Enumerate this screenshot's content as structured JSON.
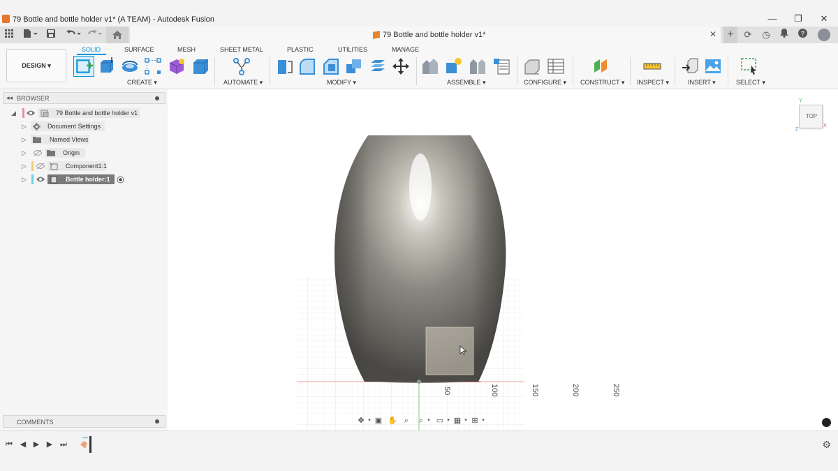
{
  "window": {
    "title": "79 Bottle and bottle holder v1* (A TEAM) - Autodesk Fusion",
    "minimize": "—",
    "maximize": "❐",
    "close": "✕"
  },
  "doc_tab": {
    "title": "79 Bottle and bottle holder v1*",
    "close": "✕"
  },
  "ribbon": {
    "workspace": "DESIGN ▾",
    "tabs": [
      "SOLID",
      "SURFACE",
      "MESH",
      "SHEET METAL",
      "PLASTIC",
      "UTILITIES",
      "MANAGE"
    ],
    "groups": [
      "CREATE ▾",
      "AUTOMATE ▾",
      "MODIFY ▾",
      "ASSEMBLE ▾",
      "CONFIGURE ▾",
      "CONSTRUCT ▾",
      "INSPECT ▾",
      "INSERT ▾",
      "SELECT ▾"
    ]
  },
  "browser": {
    "title": "BROWSER",
    "items": [
      "79 Bottle and bottle holder v1",
      "Document Settings",
      "Named Views",
      "Origin",
      "Component1:1",
      "Bottle holder:1"
    ]
  },
  "comments": {
    "title": "COMMENTS"
  },
  "viewcube": {
    "face": "TOP",
    "axis_x": "X",
    "axis_y": "Y",
    "axis_z": "Z"
  },
  "ruler": {
    "ticks": [
      "50",
      "100",
      "150",
      "200",
      "250"
    ]
  },
  "colors": {
    "accent": "#0696d7",
    "x_axis": "#e24a4a",
    "y_axis": "#4caf50",
    "bottle": "#7d7b75"
  }
}
